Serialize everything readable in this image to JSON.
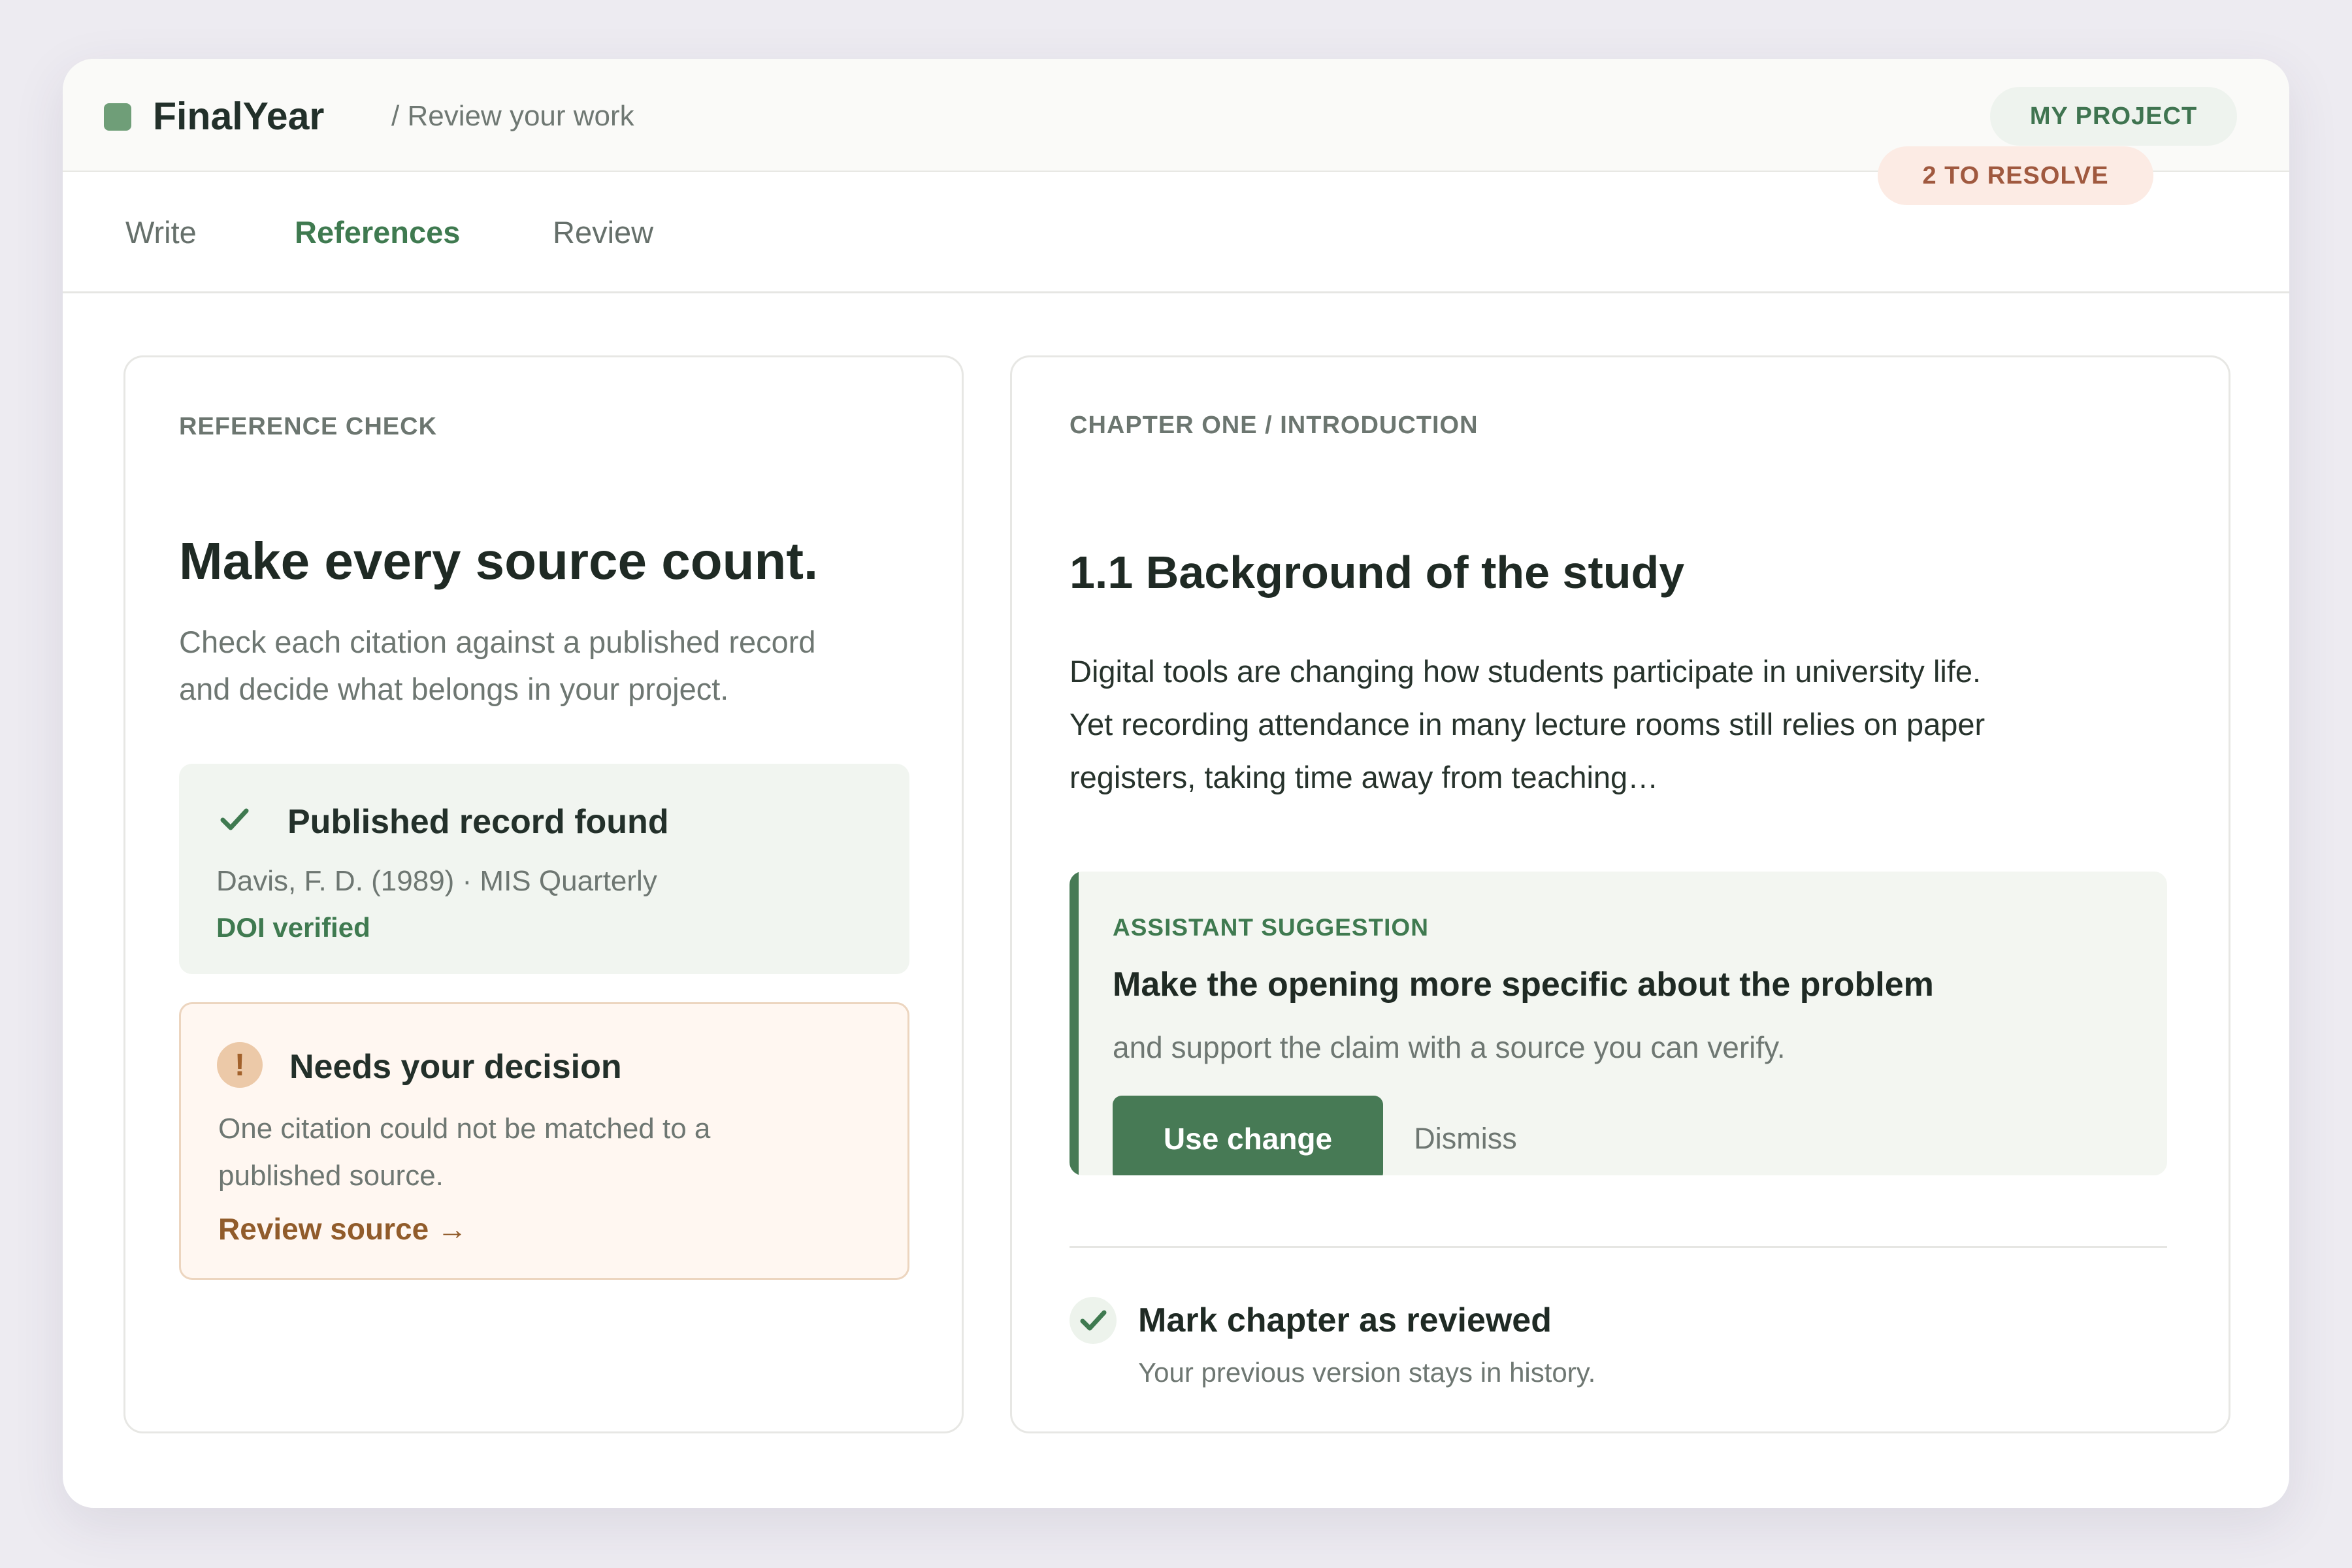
{
  "app": {
    "name": "FinalYear",
    "breadcrumb": "/ Review your work",
    "project_label": "MY PROJECT",
    "brand_color": "#6f9e78"
  },
  "tabs": [
    {
      "label": "Write",
      "active": false
    },
    {
      "label": "References",
      "active": true
    },
    {
      "label": "Review",
      "active": false
    }
  ],
  "resolve_badge": "2 TO RESOLVE",
  "reference_check": {
    "eyebrow": "REFERENCE CHECK",
    "title": "Make every source count.",
    "subtitle": "Check each citation against a published record and decide what belongs in your project.",
    "found": {
      "icon": "check-icon",
      "title": "Published record found",
      "citation": "Davis, F. D. (1989) · MIS Quarterly",
      "status": "DOI verified"
    },
    "decision": {
      "icon": "warning-icon",
      "icon_glyph": "!",
      "title": "Needs your decision",
      "text": "One citation could not be matched to a published source.",
      "link": "Review source →"
    }
  },
  "chapter": {
    "eyebrow": "CHAPTER ONE / INTRODUCTION",
    "title": "1.1 Background of the study",
    "body": "Digital tools are changing how students participate in university life. Yet recording attendance in many lecture rooms still relies on paper registers, taking time away from teaching…",
    "suggestion": {
      "eyebrow": "ASSISTANT SUGGESTION",
      "title": "Make the opening more specific about the problem",
      "subtitle": "and support the claim with a source you can verify.",
      "primary_action": "Use change",
      "secondary_action": "Dismiss",
      "accent_color": "#477a55"
    },
    "review": {
      "icon": "check-icon",
      "label": "Mark chapter as reviewed",
      "note": "Your previous version stays in history."
    }
  }
}
